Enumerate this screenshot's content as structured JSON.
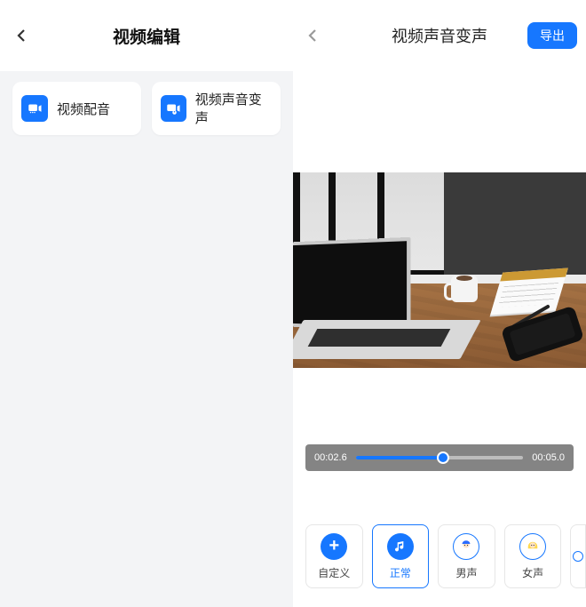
{
  "left": {
    "title": "视频编辑",
    "options": [
      {
        "label": "视频配音",
        "icon": "video-dubbing-icon"
      },
      {
        "label": "视频声音变声",
        "icon": "video-voice-change-icon"
      }
    ]
  },
  "right": {
    "title": "视频声音变声",
    "export_label": "导出",
    "playback": {
      "current": "00:02.6",
      "total": "00:05.0",
      "progress_percent": 52
    },
    "voice_options": [
      {
        "label": "自定义",
        "icon": "plus-icon",
        "selected": false
      },
      {
        "label": "正常",
        "icon": "music-note-icon",
        "selected": true
      },
      {
        "label": "男声",
        "icon": "male-face-icon",
        "selected": false
      },
      {
        "label": "女声",
        "icon": "female-face-icon",
        "selected": false
      }
    ],
    "colors": {
      "accent": "#1677ff"
    }
  }
}
